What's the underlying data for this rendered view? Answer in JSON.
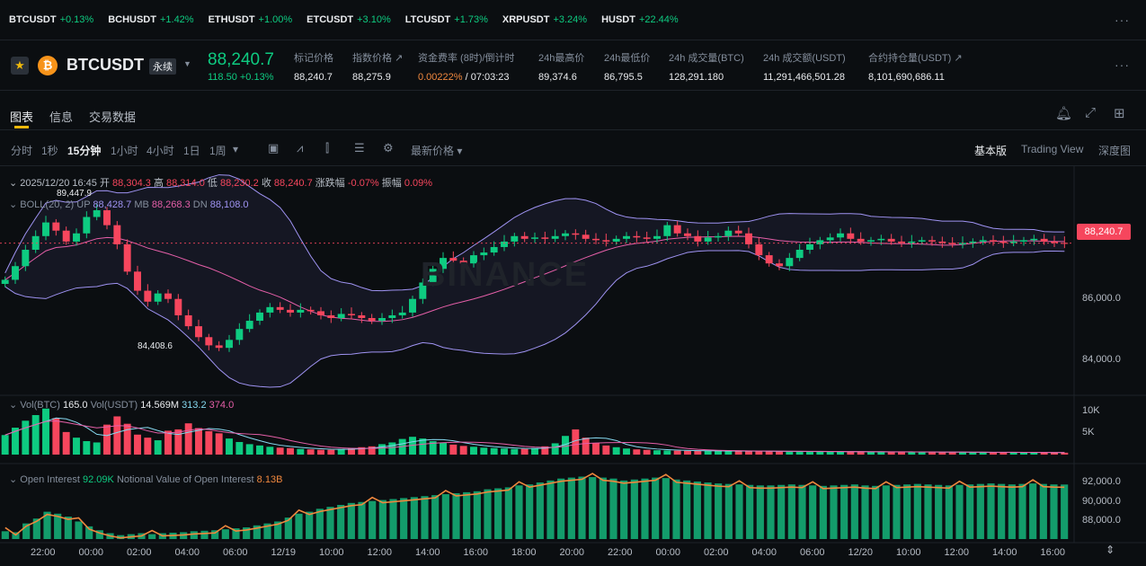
{
  "tickers": [
    {
      "symbol": "BTCUSDT",
      "change": "+0.13%"
    },
    {
      "symbol": "BCHUSDT",
      "change": "+1.42%"
    },
    {
      "symbol": "ETHUSDT",
      "change": "+1.00%"
    },
    {
      "symbol": "ETCUSDT",
      "change": "+3.10%"
    },
    {
      "symbol": "LTCUSDT",
      "change": "+1.73%"
    },
    {
      "symbol": "XRPUSDT",
      "change": "+3.24%"
    },
    {
      "symbol": "HUSDT",
      "change": "+22.44%"
    }
  ],
  "header": {
    "pair": "BTCUSDT",
    "perp_label": "永续",
    "coin_glyph": "₿",
    "last_price": "88,240.7",
    "last_change": "118.50 +0.13%",
    "stats": [
      {
        "label": "标记价格",
        "value": "88,240.7"
      },
      {
        "label": "指数价格 ↗",
        "value": "88,275.9"
      },
      {
        "label": "资金费率 (8时)/倒计时",
        "value_a": "0.00222%",
        "value_b": " / 07:03:23"
      },
      {
        "label": "24h最高价",
        "value": "89,374.6"
      },
      {
        "label": "24h最低价",
        "value": "86,795.5"
      },
      {
        "label": "24h 成交量(BTC)",
        "value": "128,291.180"
      },
      {
        "label": "24h 成交额(USDT)",
        "value": "11,291,466,501.28"
      },
      {
        "label": "合约持仓量(USDT) ↗",
        "value": "8,101,690,686.11"
      }
    ]
  },
  "tabs": [
    "图表",
    "信息",
    "交易数据"
  ],
  "timeframes": [
    "分时",
    "1秒",
    "15分钟",
    "1小时",
    "4小时",
    "1日",
    "1周"
  ],
  "timeframe_more": "▾",
  "price_type": "最新价格 ▾",
  "modes": [
    "基本版",
    "Trading View",
    "深度图"
  ],
  "ohlc": {
    "date": "2025/12/20 16:45",
    "open_label": "开",
    "open": "88,304.3",
    "high_label": "高",
    "high": "88,314.0",
    "low_label": "低",
    "low": "88,230.2",
    "close_label": "收",
    "close": "88,240.7",
    "chg_label": "涨跌幅",
    "chg": "-0.07%",
    "amp_label": "振幅",
    "amp": "0.09%"
  },
  "boll": {
    "label": "BOLL(20, 2)",
    "up_label": "UP",
    "up": "88,428.7",
    "mb_label": "MB",
    "mb": "88,268.3",
    "dn_label": "DN",
    "dn": "88,108.0"
  },
  "vol": {
    "label": "Vol(BTC)",
    "btc": "165.0",
    "usdt_label": "Vol(USDT)",
    "usdt": "14.569M",
    "ma1": "313.2",
    "ma2": "374.0"
  },
  "oi": {
    "label": "Open Interest",
    "value": "92.09K",
    "nv_label": "Notional Value of Open Interest",
    "nv": "8.13B"
  },
  "price_tag": "88,240.7",
  "annotations": {
    "high": "89,447.9",
    "low": "84,408.6"
  },
  "watermark": "BINANCE",
  "y_price_labels": [
    "86,000.0",
    "84,000.0"
  ],
  "y_vol_labels": [
    "10K",
    "5K"
  ],
  "y_oi_labels": [
    "92,000.0",
    "90,000.0",
    "88,000.0"
  ],
  "x_labels": [
    "22:00",
    "00:00",
    "02:00",
    "04:00",
    "06:00",
    "12/19",
    "10:00",
    "12:00",
    "14:00",
    "16:00",
    "18:00",
    "20:00",
    "22:00",
    "00:00",
    "02:00",
    "04:00",
    "06:00",
    "12/20",
    "10:00",
    "12:00",
    "14:00",
    "16:00"
  ],
  "colors": {
    "up": "#0ecb81",
    "down": "#f6465d",
    "boll_band": "#9f93f2",
    "boll_mid": "#e55fa8",
    "oi_line": "#f0883e",
    "accent": "#f0b90b"
  },
  "chart_data": {
    "type": "candlestick",
    "title": "",
    "timeframe": "15分钟",
    "price_range": [
      83000,
      90500
    ],
    "closes": [
      86900,
      87400,
      88000,
      88500,
      89000,
      88700,
      88300,
      88600,
      89200,
      89447,
      88900,
      88200,
      87200,
      86500,
      86100,
      86400,
      86200,
      85600,
      85200,
      84800,
      84500,
      84408,
      84700,
      85100,
      85400,
      85700,
      85900,
      85800,
      85700,
      85800,
      85750,
      85600,
      85500,
      85650,
      85600,
      85500,
      85400,
      85500,
      85600,
      85700,
      86200,
      86800,
      87300,
      87700,
      87600,
      87500,
      87800,
      87900,
      88100,
      88300,
      88500,
      88400,
      88450,
      88400,
      88500,
      88600,
      88550,
      88400,
      88350,
      88300,
      88400,
      88500,
      88450,
      88400,
      88500,
      88900,
      88600,
      88500,
      88300,
      88450,
      88500,
      88700,
      88600,
      88200,
      87800,
      87500,
      87400,
      87700,
      88000,
      88200,
      88350,
      88450,
      88600,
      88400,
      88300,
      88350,
      88400,
      88300,
      88250,
      88300,
      88350,
      88300,
      88250,
      88200,
      88250,
      88300,
      88350,
      88300,
      88250,
      88300,
      88350,
      88400,
      88300,
      88250,
      88240.7
    ],
    "volumes": [
      4500,
      6200,
      7800,
      9100,
      10600,
      8400,
      5200,
      3900,
      3100,
      2800,
      6900,
      8800,
      7100,
      4600,
      3900,
      3300,
      5500,
      5800,
      7200,
      6100,
      5400,
      4900,
      3700,
      2900,
      2400,
      2100,
      1800,
      1600,
      1500,
      1300,
      1200,
      1100,
      1100,
      1300,
      1500,
      1700,
      1900,
      2400,
      2800,
      3600,
      4100,
      3700,
      3100,
      2700,
      2300,
      2000,
      1800,
      1600,
      1500,
      1400,
      1300,
      1300,
      1500,
      1900,
      2600,
      4300,
      5800,
      3900,
      2700,
      2100,
      1700,
      1400,
      1200,
      1100,
      1000,
      950,
      900,
      880,
      860,
      840,
      820,
      800,
      790,
      780,
      760,
      740,
      730,
      720,
      700,
      690,
      680,
      670,
      660,
      650,
      640,
      630,
      620,
      610,
      600,
      590,
      580,
      570,
      560,
      550,
      540,
      530,
      520,
      510,
      500,
      490,
      480,
      470,
      460,
      450,
      440
    ],
    "open_interest": [
      87300,
      87200,
      88100,
      88600,
      89300,
      89100,
      88800,
      88300,
      87800,
      87400,
      87100,
      86900,
      87000,
      87100,
      87000,
      87100,
      87150,
      87200,
      87300,
      87350,
      87400,
      87500,
      87600,
      87700,
      87900,
      88100,
      88300,
      88700,
      89100,
      89300,
      89600,
      89800,
      90000,
      90200,
      90300,
      90400,
      90500,
      90600,
      90700,
      90800,
      90900,
      91000,
      91100,
      91200,
      91300,
      91400,
      91600,
      91700,
      91800,
      92000,
      92100,
      92300,
      92500,
      92700,
      92800,
      92900,
      92850,
      92800,
      92700,
      92500,
      92600,
      92700,
      92800,
      92750,
      92600,
      92500,
      92400,
      92300,
      92200,
      92150,
      92100,
      92050,
      92000,
      92000,
      92050,
      92100,
      92050,
      92000,
      91950,
      92000,
      92050,
      92100,
      92000,
      91950,
      92000,
      92050,
      92100,
      92150,
      92100,
      92050,
      92000,
      92050,
      92100,
      92150,
      92200,
      92150,
      92100,
      92150,
      92200,
      92150,
      92100,
      92090
    ],
    "vol_ylim": [
      0,
      12000
    ],
    "oi_ylim": [
      86500,
      93500
    ]
  }
}
